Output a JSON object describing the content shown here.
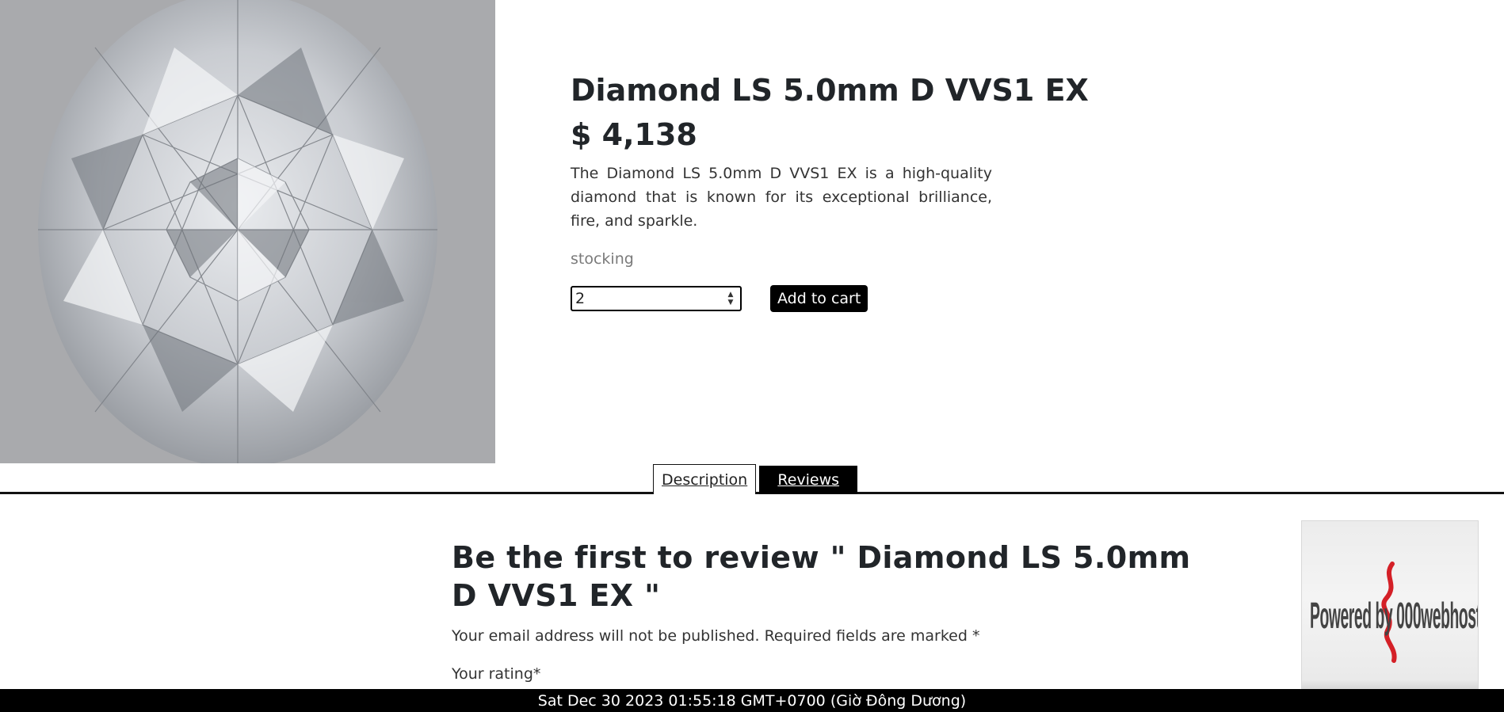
{
  "product": {
    "title": "Diamond LS 5.0mm D VVS1 EX",
    "price": "$ 4,138",
    "description": "The Diamond LS 5.0mm D VVS1 EX is a high-quality diamond that is known for its exceptional brilliance, fire, and sparkle.",
    "stock_status": "stocking",
    "quantity": "2",
    "add_to_cart_label": "Add to cart"
  },
  "tabs": [
    {
      "label": "Description",
      "active": true
    },
    {
      "label": "Reviews",
      "active": false
    }
  ],
  "review": {
    "title": "Be the first to review \" Diamond LS 5.0mm D VVS1 EX \"",
    "note": "Your email address will not be published. Required fields are marked *",
    "rating_label": "Your rating*"
  },
  "badge": {
    "text": "Powered by 000webhost"
  },
  "footer": {
    "datetime": "Sat Dec 30 2023 01:55:18 GMT+0700 (Giờ Đông Dương)"
  },
  "colors": {
    "image_background": "#a9aaad",
    "button_background": "#000000",
    "text": "#212529",
    "stock_text": "#7a7a7a"
  }
}
